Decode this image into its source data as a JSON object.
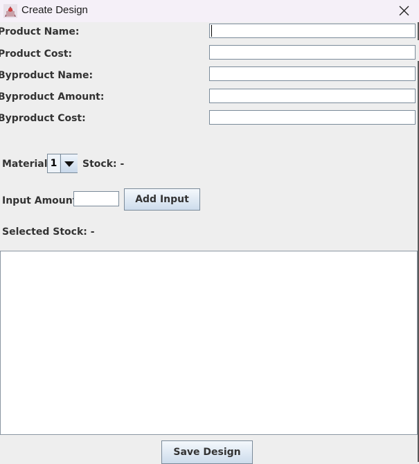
{
  "window": {
    "title": "Create Design"
  },
  "form": {
    "product_name_label": "Product Name:",
    "product_cost_label": "Product Cost:",
    "byproduct_name_label": "Byproduct Name:",
    "byproduct_amount_label": "Byproduct Amount:",
    "byproduct_cost_label": "Byproduct Cost:",
    "product_name_value": "",
    "product_cost_value": "",
    "byproduct_name_value": "",
    "byproduct_amount_value": "",
    "byproduct_cost_value": ""
  },
  "material": {
    "label": "Material:",
    "selected": "1",
    "stock_text": "Stock: -"
  },
  "input": {
    "label": "Input Amount:",
    "value": "",
    "add_button": "Add Input"
  },
  "selected_stock_text": "Selected Stock: -",
  "inputs_list": {
    "content": ""
  },
  "save_button": "Save Design",
  "icons": {
    "app": "app-icon",
    "close": "close-icon",
    "dropdown": "chevron-down-icon"
  }
}
